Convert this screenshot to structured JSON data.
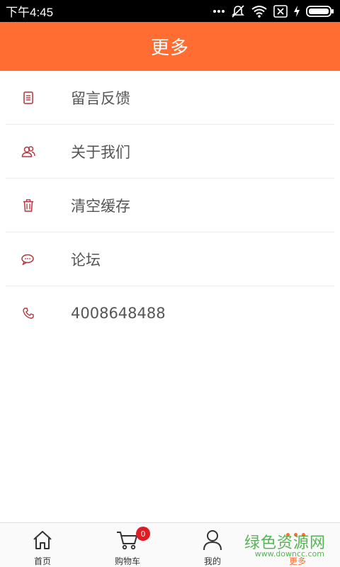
{
  "status_bar": {
    "time": "下午4:45"
  },
  "header": {
    "title": "更多"
  },
  "menu": {
    "items": [
      {
        "label": "留言反馈",
        "icon": "document-icon"
      },
      {
        "label": "关于我们",
        "icon": "users-icon"
      },
      {
        "label": "清空缓存",
        "icon": "trash-icon"
      },
      {
        "label": "论坛",
        "icon": "chat-bubble-icon"
      },
      {
        "label": "4008648488",
        "icon": "phone-icon"
      }
    ]
  },
  "tabs": [
    {
      "label": "首页",
      "icon": "home-icon"
    },
    {
      "label": "购物车",
      "icon": "cart-icon",
      "badge": "0"
    },
    {
      "label": "我的",
      "icon": "user-icon"
    },
    {
      "label": "更多",
      "icon": "more-icon",
      "active": true
    }
  ],
  "watermark": {
    "text": "绿色资源网",
    "sub": "www.downcc.com"
  },
  "colors": {
    "accent": "#ff6d32",
    "icon_red": "#b8343c",
    "badge": "#e01b24"
  }
}
